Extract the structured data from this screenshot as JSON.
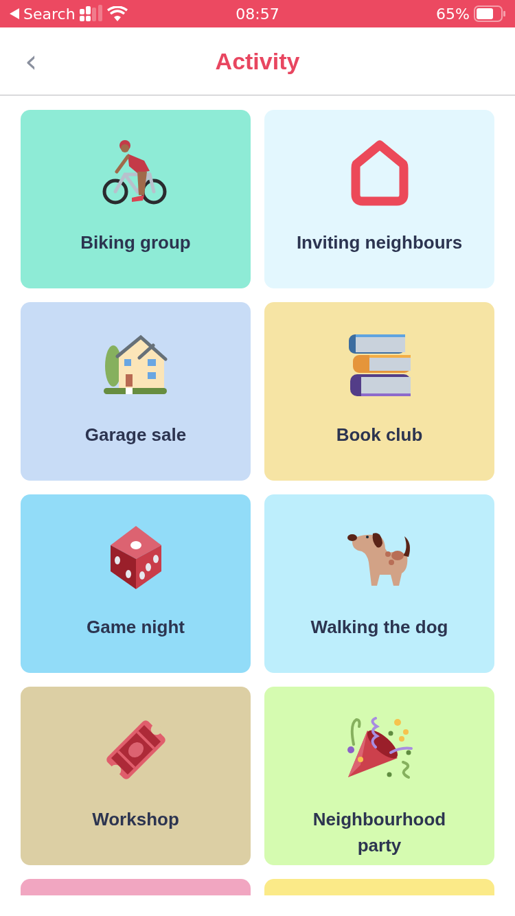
{
  "status_bar": {
    "back_label": "Search",
    "time": "08:57",
    "battery": "65%"
  },
  "header": {
    "back": "‹",
    "title": "Activity"
  },
  "activities": [
    {
      "label": "Biking group",
      "kind": "cyclist",
      "color": "#8eebd6"
    },
    {
      "label": "Inviting neighbours",
      "kind": "home",
      "color": "#e3f7fe"
    },
    {
      "label": "Garage sale",
      "kind": "house",
      "color": "#c8dcf6"
    },
    {
      "label": "Book club",
      "kind": "books",
      "color": "#f6e4a4"
    },
    {
      "label": "Game night",
      "kind": "dice",
      "color": "#92dcf8"
    },
    {
      "label": "Walking the dog",
      "kind": "dog",
      "color": "#bdeefc"
    },
    {
      "label": "Workshop",
      "kind": "ticket",
      "color": "#dccfa4"
    },
    {
      "label": "Neighbourhood party",
      "kind": "party",
      "color": "#d5fbb0"
    },
    {
      "color": "#f1a6c1"
    },
    {
      "color": "#fbea88"
    }
  ]
}
